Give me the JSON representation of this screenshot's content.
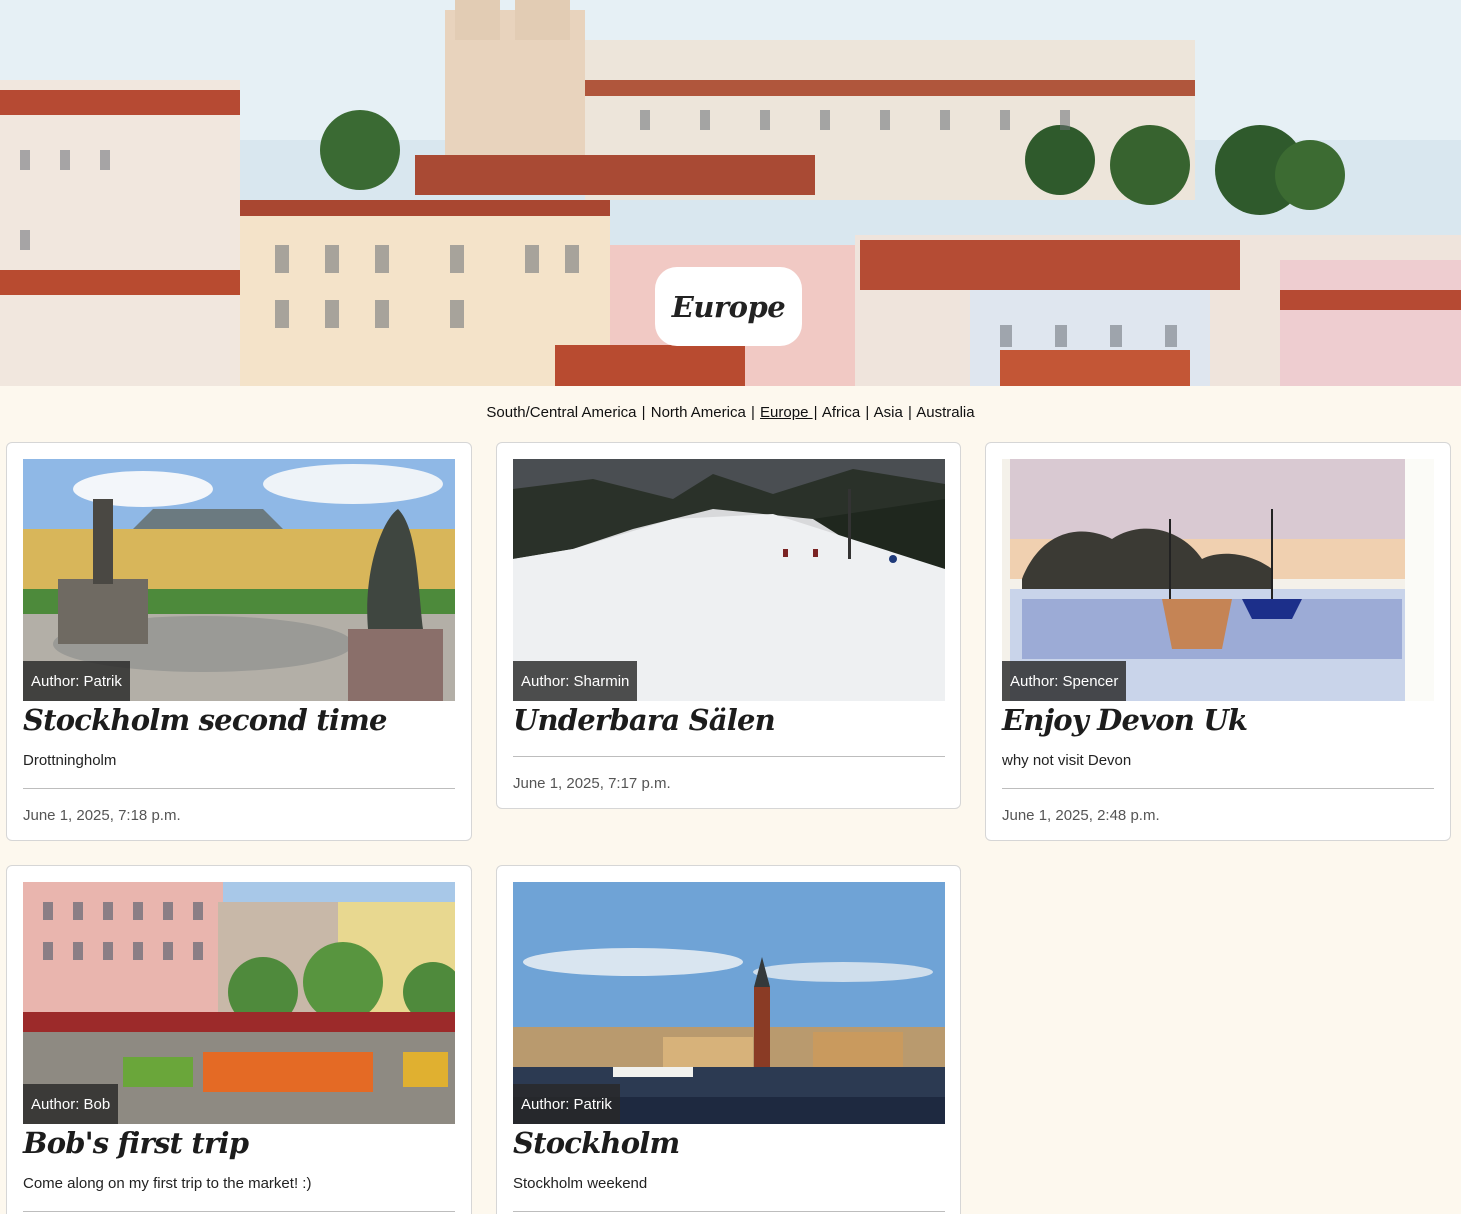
{
  "hero": {
    "title": "Europe"
  },
  "nav": {
    "regions": [
      {
        "label": "South/Central America",
        "active": false
      },
      {
        "label": "North America",
        "active": false
      },
      {
        "label": "Europe ",
        "active": true
      },
      {
        "label": "Africa",
        "active": false
      },
      {
        "label": "Asia",
        "active": false
      },
      {
        "label": "Australia",
        "active": false
      }
    ],
    "separator": "|"
  },
  "posts": [
    {
      "author": "Author: Patrik",
      "title": "Stockholm second time",
      "excerpt": "Drottningholm",
      "date": "June 1, 2025, 7:18 p.m.",
      "image": "palace-fountain"
    },
    {
      "author": "Author: Sharmin",
      "title": "Underbara Sälen",
      "excerpt": "",
      "date": "June 1, 2025, 7:17 p.m.",
      "image": "ski-slope"
    },
    {
      "author": "Author: Spencer",
      "title": "Enjoy Devon Uk",
      "excerpt": "why not visit Devon",
      "date": "June 1, 2025, 2:48 p.m.",
      "image": "watercolor-boats"
    },
    {
      "author": "Author: Bob",
      "title": "Bob's first trip",
      "excerpt": "Come along on my first trip to the market! :)",
      "date": "",
      "image": "market-square"
    },
    {
      "author": "Author: Patrik",
      "title": "Stockholm",
      "excerpt": "Stockholm weekend",
      "date": "",
      "image": "city-waterfront"
    }
  ],
  "colors": {
    "background": "#fdf8ee",
    "card": "#ffffff",
    "badge": "#282828"
  }
}
